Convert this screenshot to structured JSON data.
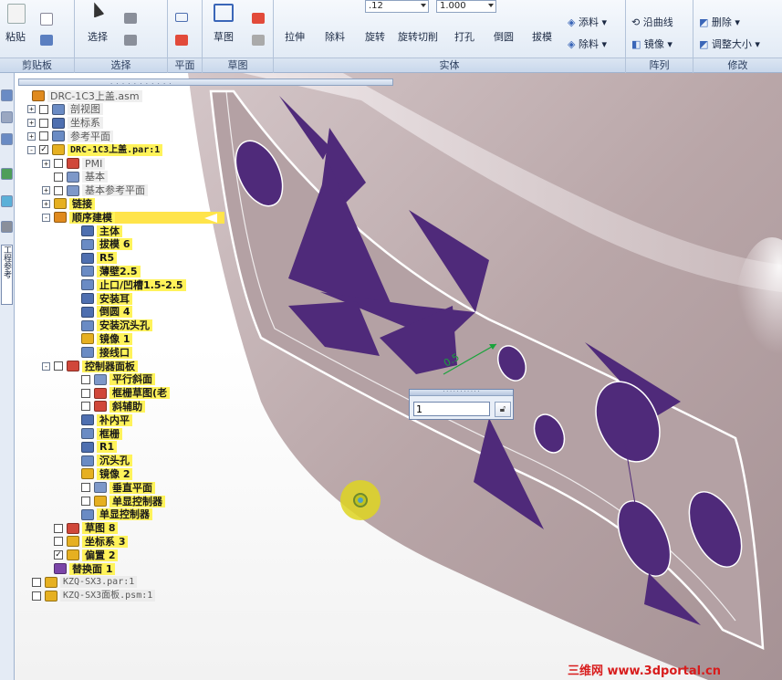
{
  "ribbon": {
    "groups": [
      "剪贴板",
      "选择",
      "平面",
      "草图",
      "实体",
      "阵列",
      "修改"
    ],
    "clipboard_paste": "粘贴",
    "select": "选择",
    "sketch": "草图",
    "solid_buttons": [
      "拉伸",
      "除料",
      "旋转",
      "旋转切削",
      "打孔",
      "倒圆",
      "拔模"
    ],
    "thickness_combo": ".12",
    "scale_combo": "1.000",
    "add_label": "添料",
    "remove_label": "除料",
    "along_curve": "沿曲线",
    "mirror": "镜像",
    "delete": "删除",
    "resize": "调整大小"
  },
  "left_strip": {
    "tab_label": "工程参考"
  },
  "tree": [
    {
      "text": "DRC-1C3上盖.asm",
      "level": 0,
      "expander": "",
      "check": false,
      "style": "dim",
      "icon": "assembly-icon",
      "iconColor": "#e08a1e"
    },
    {
      "text": "剖视图",
      "level": 1,
      "expander": "+",
      "check": true,
      "checked": false,
      "style": "dim",
      "icon": "section-view-icon",
      "iconColor": "#6a8bc4"
    },
    {
      "text": "坐标系",
      "level": 1,
      "expander": "+",
      "check": true,
      "checked": false,
      "style": "dim",
      "icon": "coordinate-system-icon",
      "iconColor": "#4e6fb0"
    },
    {
      "text": "参考平面",
      "level": 1,
      "expander": "+",
      "check": true,
      "checked": false,
      "style": "dim",
      "icon": "reference-plane-icon",
      "iconColor": "#6a8bc4"
    },
    {
      "text": "DRC-1C3上盖.par:1",
      "level": 1,
      "expander": "-",
      "check": true,
      "checked": true,
      "style": "hl mono",
      "icon": "part-icon",
      "iconColor": "#e6b021"
    },
    {
      "text": "PMI",
      "level": 2,
      "expander": "+",
      "check": true,
      "checked": false,
      "style": "dim",
      "icon": "pmi-icon",
      "iconColor": "#d0473a"
    },
    {
      "text": "基本",
      "level": 2,
      "expander": "",
      "check": true,
      "checked": false,
      "style": "dim",
      "icon": "base-icon",
      "iconColor": "#7d98c9"
    },
    {
      "text": "基本参考平面",
      "level": 2,
      "expander": "+",
      "check": true,
      "checked": false,
      "style": "dim",
      "icon": "base-reference-planes-icon",
      "iconColor": "#7d98c9"
    },
    {
      "text": "链接",
      "level": 2,
      "expander": "+",
      "check": false,
      "style": "hl",
      "icon": "link-icon",
      "iconColor": "#e6b021"
    },
    {
      "text": "顺序建模",
      "level": 2,
      "expander": "-",
      "check": false,
      "style": "hl",
      "icon": "ordered-modeling-icon",
      "iconColor": "#e08a1e",
      "arrow": true
    },
    {
      "text": "主体",
      "level": 3,
      "expander": "",
      "check": false,
      "style": "hl",
      "icon": "body-icon",
      "iconColor": "#4e6fb0"
    },
    {
      "text": "拔模 6",
      "level": 3,
      "expander": "",
      "check": false,
      "style": "hl",
      "icon": "draft-icon",
      "iconColor": "#6a8bc4"
    },
    {
      "text": "R5",
      "level": 3,
      "expander": "",
      "check": false,
      "style": "hl",
      "icon": "round-icon",
      "iconColor": "#4e6fb0"
    },
    {
      "text": "薄壁2.5",
      "level": 3,
      "expander": "",
      "check": false,
      "style": "hl",
      "icon": "thin-wall-icon",
      "iconColor": "#6a8bc4"
    },
    {
      "text": "止口/凹槽1.5-2.5",
      "level": 3,
      "expander": "",
      "check": false,
      "style": "hl",
      "icon": "lip-groove-icon",
      "iconColor": "#6a8bc4"
    },
    {
      "text": "安装耳",
      "level": 3,
      "expander": "",
      "check": false,
      "style": "hl",
      "icon": "mount-ear-icon",
      "iconColor": "#4e6fb0"
    },
    {
      "text": "倒圆 4",
      "level": 3,
      "expander": "",
      "check": false,
      "style": "hl",
      "icon": "round-icon",
      "iconColor": "#4e6fb0"
    },
    {
      "text": "安装沉头孔",
      "level": 3,
      "expander": "",
      "check": false,
      "style": "hl",
      "icon": "counterbore-hole-icon",
      "iconColor": "#6a8bc4"
    },
    {
      "text": "镜像 1",
      "level": 3,
      "expander": "",
      "check": false,
      "style": "hl",
      "icon": "mirror-icon",
      "iconColor": "#e6b021"
    },
    {
      "text": "接线口",
      "level": 3,
      "expander": "",
      "check": false,
      "style": "hl",
      "icon": "wire-port-icon",
      "iconColor": "#6a8bc4"
    },
    {
      "text": "控制器面板",
      "level": 2,
      "expander": "-",
      "check": true,
      "checked": false,
      "style": "hl",
      "icon": "sketch-icon",
      "iconColor": "#d0473a"
    },
    {
      "text": "平行斜面",
      "level": 3,
      "expander": "",
      "check": true,
      "checked": false,
      "style": "hl",
      "icon": "plane-icon",
      "iconColor": "#7d98c9"
    },
    {
      "text": "框栅草图(老",
      "level": 3,
      "expander": "",
      "check": true,
      "checked": false,
      "style": "hl",
      "icon": "sketch-icon",
      "iconColor": "#d0473a"
    },
    {
      "text": "斜辅助",
      "level": 3,
      "expander": "",
      "check": true,
      "checked": false,
      "style": "hl",
      "icon": "sketch-icon",
      "iconColor": "#d0473a"
    },
    {
      "text": "补内平",
      "level": 3,
      "expander": "",
      "check": false,
      "style": "hl",
      "icon": "fill-icon",
      "iconColor": "#4e6fb0"
    },
    {
      "text": "框栅",
      "level": 3,
      "expander": "",
      "check": false,
      "style": "hl",
      "icon": "grid-cut-icon",
      "iconColor": "#6a8bc4"
    },
    {
      "text": "R1",
      "level": 3,
      "expander": "",
      "check": false,
      "style": "hl",
      "icon": "round-icon",
      "iconColor": "#4e6fb0"
    },
    {
      "text": "沉头孔",
      "level": 3,
      "expander": "",
      "check": false,
      "style": "hl",
      "icon": "counterbore-hole-icon",
      "iconColor": "#6a8bc4"
    },
    {
      "text": "镜像 2",
      "level": 3,
      "expander": "",
      "check": false,
      "style": "hl",
      "icon": "mirror-icon",
      "iconColor": "#e6b021"
    },
    {
      "text": "垂直平面",
      "level": 3,
      "expander": "",
      "check": true,
      "checked": false,
      "style": "hl",
      "icon": "plane-icon",
      "iconColor": "#7d98c9"
    },
    {
      "text": "单显控制器",
      "level": 3,
      "expander": "",
      "check": true,
      "checked": false,
      "style": "hl",
      "icon": "link-icon",
      "iconColor": "#e6b021"
    },
    {
      "text": "单显控制器",
      "level": 3,
      "expander": "",
      "check": false,
      "style": "hl",
      "icon": "body-icon",
      "iconColor": "#6a8bc4"
    },
    {
      "text": "草图 8",
      "level": 2,
      "expander": "",
      "check": true,
      "checked": false,
      "style": "hl",
      "icon": "sketch-icon",
      "iconColor": "#d0473a"
    },
    {
      "text": "坐标系 3",
      "level": 2,
      "expander": "",
      "check": true,
      "checked": false,
      "style": "hl",
      "icon": "coordinate-system-icon",
      "iconColor": "#e6b021"
    },
    {
      "text": "偏置 2",
      "level": 2,
      "expander": "",
      "check": true,
      "checked": true,
      "style": "hl",
      "icon": "offset-icon",
      "iconColor": "#e6b021"
    },
    {
      "text": "替换面 1",
      "level": 2,
      "expander": "",
      "check": false,
      "style": "hl",
      "icon": "replace-face-icon",
      "iconColor": "#7b45a8"
    },
    {
      "text": "KZQ-SX3.par:1",
      "level": 0,
      "expander": "",
      "check": true,
      "checked": false,
      "style": "dim mono",
      "icon": "part-icon",
      "iconColor": "#e6b021"
    },
    {
      "text": "KZQ-SX3面板.psm:1",
      "level": 0,
      "expander": "",
      "check": true,
      "checked": false,
      "style": "dim mono",
      "icon": "sheet-metal-icon",
      "iconColor": "#e6b021"
    }
  ],
  "viewport": {
    "dimension_value": "0.5",
    "input_value": "1",
    "colors": {
      "model_body": "#b9a6a8",
      "cutouts": "#4f2a7a",
      "dimension": "#19a33b"
    }
  },
  "watermark": "三维网 www.3dportal.cn"
}
